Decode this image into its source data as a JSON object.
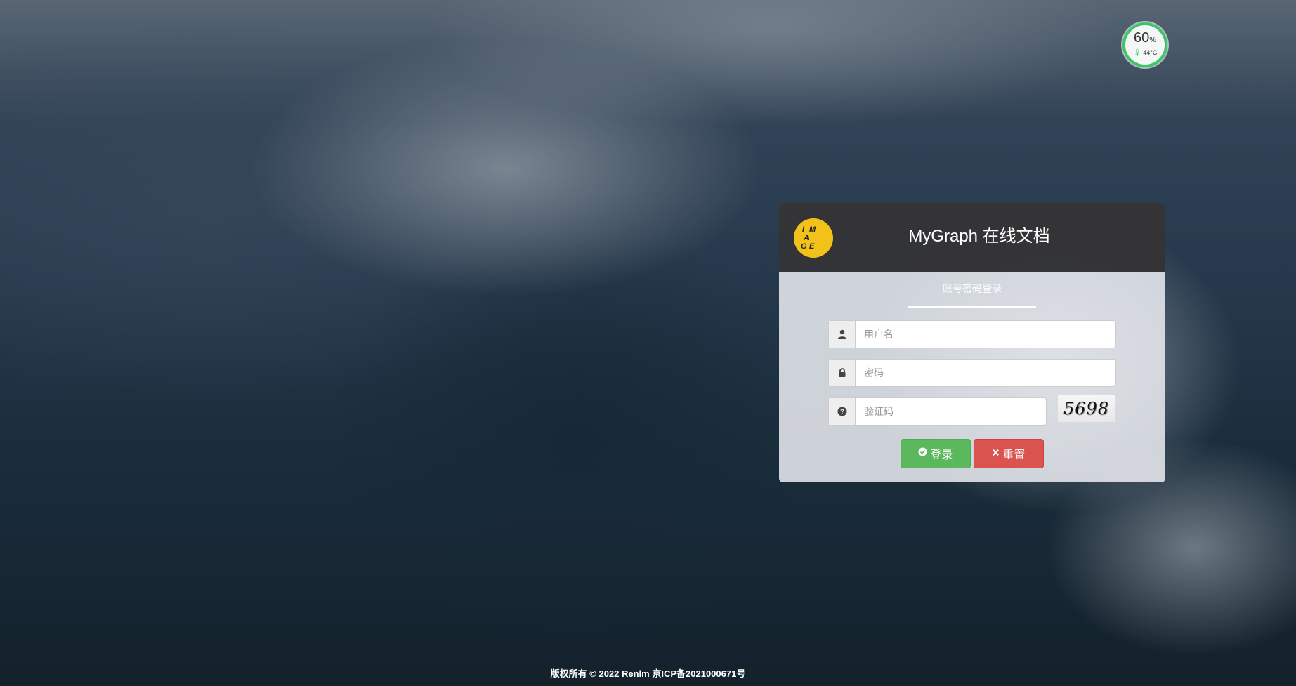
{
  "status_gauge": {
    "percent": "60",
    "percent_unit": "%",
    "temperature": "44°C",
    "accent_color": "#3ec46b"
  },
  "login": {
    "logo_letters": [
      "I",
      "M",
      "A",
      "G",
      "E"
    ],
    "title": "MyGraph 在线文档",
    "tab_label": "账号密码登录",
    "username": {
      "placeholder": "用户名",
      "value": "",
      "icon": "user-icon"
    },
    "password": {
      "placeholder": "密码",
      "value": "",
      "icon": "lock-icon"
    },
    "captcha": {
      "placeholder": "验证码",
      "value": "",
      "icon": "question-circle-icon",
      "image_text": "5698"
    },
    "login_button": {
      "label": "登录",
      "icon": "check-circle-icon",
      "color": "#5cb85c"
    },
    "reset_button": {
      "label": "重置",
      "icon": "times-icon",
      "color": "#d9534f"
    }
  },
  "footer": {
    "copyright": "版权所有 © 2022 Renlm",
    "icp_link": "京ICP备2021000671号"
  }
}
